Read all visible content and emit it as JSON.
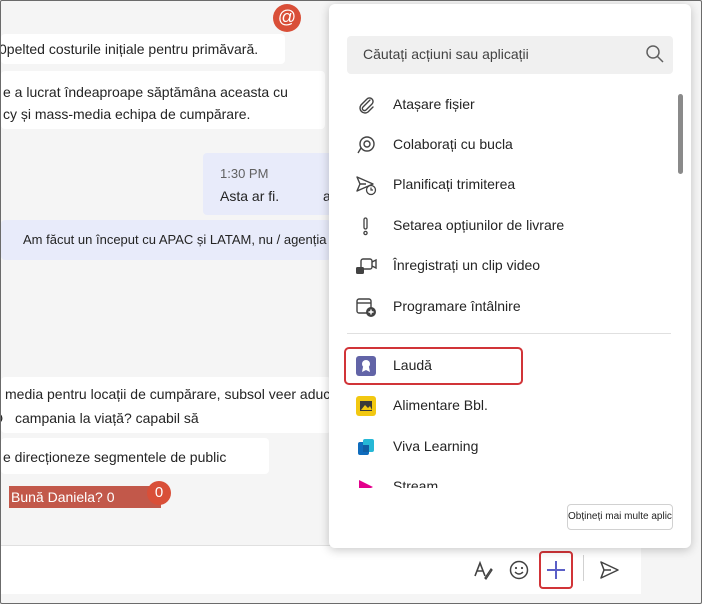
{
  "chat": {
    "messages": [
      "0pelted costurile inițiale pentru primăvară.",
      "e  a lucrat îndeaproape săptămâna aceasta cu",
      "cy și mass-media echipa de cumpărare.",
      "Asta ar fi.",
      "a",
      "Am făcut un început cu APAC și LATAM, nu / agenția",
      "media pentru locații de cumpărare, subsol veer aduce",
      "campania la viață? capabil să",
      "e  direcționeze segmentele de public",
      "Bună Daniela? 0"
    ],
    "timestamp": "1:30 PM",
    "mention_symbol": "@",
    "glyph_d": "D",
    "glyph_sub": "0",
    "glyph_e": "e"
  },
  "apps_menu": {
    "search_placeholder": "Căutați acțiuni sau aplicații",
    "actions": [
      {
        "label": "Atașare fișier",
        "icon": "paperclip-icon"
      },
      {
        "label": "Colaborați cu bucla",
        "icon": "loop-icon"
      },
      {
        "label": "Planificați trimiterea",
        "icon": "schedule-send-icon"
      },
      {
        "label": "Setarea opțiunilor de livrare",
        "icon": "exclamation-icon"
      },
      {
        "label": "Înregistrați un clip video",
        "icon": "video-clip-icon"
      },
      {
        "label": "Programare întâlnire",
        "icon": "calendar-add-icon"
      }
    ],
    "apps": [
      {
        "label": "Laudă",
        "icon": "praise-icon"
      },
      {
        "label": "Alimentare Bbl.",
        "icon": "image-feed-icon"
      },
      {
        "label": "Viva Learning",
        "icon": "viva-learning-icon"
      },
      {
        "label": "Stream",
        "icon": "stream-icon"
      }
    ],
    "more_apps": "Obțineți mai multe aplicații"
  },
  "colors": {
    "accent": "#5b5fc7",
    "highlight_red": "#d13438",
    "mention_red": "#d94f38"
  }
}
